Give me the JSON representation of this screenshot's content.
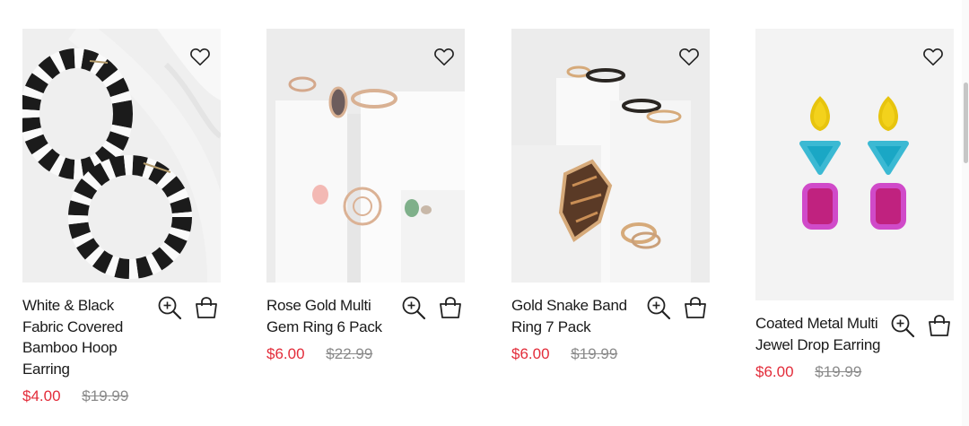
{
  "products": [
    {
      "name": "White & Black Fabric Covered Bamboo Hoop Earring",
      "price": "$4.00",
      "was": "$19.99",
      "image": "zebra-hoop-earrings"
    },
    {
      "name": "Rose Gold Multi Gem Ring 6 Pack",
      "price": "$6.00",
      "was": "$22.99",
      "image": "rose-gold-rings"
    },
    {
      "name": "Gold Snake Band Ring 7 Pack",
      "price": "$6.00",
      "was": "$19.99",
      "image": "snake-rings"
    },
    {
      "name": "Coated Metal Multi Jewel Drop Earring",
      "price": "$6.00",
      "was": "$19.99",
      "image": "jewel-drop-earrings"
    }
  ],
  "icons": {
    "wishlist": "heart-icon",
    "quickview": "zoom-in-icon",
    "cart": "shopping-bag-icon"
  },
  "colors": {
    "sale_price": "#e32c3a",
    "was_price": "#8a8a8a"
  }
}
